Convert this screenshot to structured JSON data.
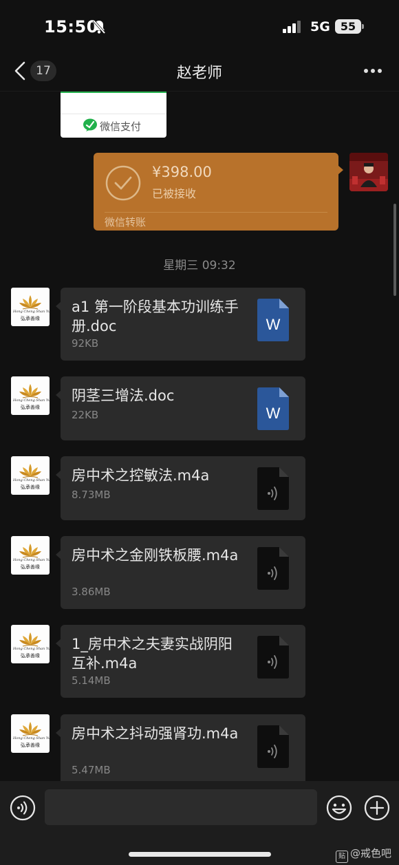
{
  "status": {
    "time": "15:50",
    "network": "5G",
    "battery": "55"
  },
  "header": {
    "back_count": "17",
    "title": "赵老师"
  },
  "pay_card": {
    "label": "微信支付"
  },
  "transfer": {
    "amount": "¥398.00",
    "status": "已被接收",
    "footer": "微信转账"
  },
  "timestamp": "星期三 09:32",
  "sender_avatar": {
    "line1": "Hong Cheng Shan Yuan",
    "line2": "弘承善缘"
  },
  "files": [
    {
      "name": "a1 第一阶段基本功训练手册.doc",
      "size": "92KB",
      "type": "word"
    },
    {
      "name": "阴茎三增法.doc",
      "size": "22KB",
      "type": "word"
    },
    {
      "name": "房中术之控敏法.m4a",
      "size": "8.73MB",
      "type": "audio"
    },
    {
      "name": "房中术之金刚铁板腰.m4a",
      "size": "3.86MB",
      "type": "audio"
    },
    {
      "name": "1_房中术之夫妻实战阴阳互补.m4a",
      "size": "5.14MB",
      "type": "audio"
    },
    {
      "name": "房中术之抖动强肾功.m4a",
      "size": "5.47MB",
      "type": "audio"
    }
  ],
  "word_icon_letter": "W",
  "watermark": {
    "box": "贴",
    "text": "@戒色吧"
  },
  "colors": {
    "background": "#111111",
    "transfer": "#b8722b",
    "bubble": "#2b2b2b",
    "word_blue": "#2b579a"
  }
}
